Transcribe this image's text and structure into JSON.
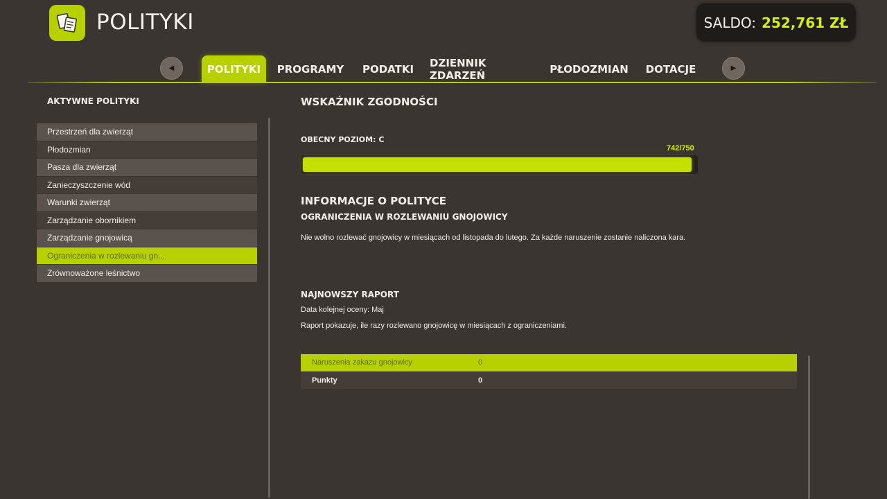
{
  "header": {
    "icon": "documents-icon",
    "title": "POLITYKI",
    "balance_label": "SALDO:",
    "balance_value": "252,761 ZŁ"
  },
  "nav": {
    "prev_icon": "arrow-left-icon",
    "next_icon": "arrow-right-icon",
    "tabs": [
      {
        "label": "POLITYKI",
        "active": true
      },
      {
        "label": "PROGRAMY",
        "active": false
      },
      {
        "label": "PODATKI",
        "active": false
      },
      {
        "label": "DZIENNIK ZDARZEŃ",
        "active": false
      },
      {
        "label": "PŁODOZMIAN",
        "active": false
      },
      {
        "label": "DOTACJE",
        "active": false
      }
    ]
  },
  "sidebar": {
    "heading": "AKTYWNE POLITYKI",
    "items": [
      {
        "label": "Przestrzeń dla zwierząt"
      },
      {
        "label": "Płodozmian"
      },
      {
        "label": "Pasza dla zwierząt"
      },
      {
        "label": "Zanieczyszczenie wód"
      },
      {
        "label": "Warunki zwierząt"
      },
      {
        "label": "Zarządzanie obornikiem"
      },
      {
        "label": "Zarządzanie gnojowicą"
      },
      {
        "label": "Ograniczenia w rozlewaniu gn..."
      },
      {
        "label": "Zrównoważone leśnictwo"
      }
    ],
    "selected_index": 7
  },
  "compliance": {
    "heading": "WSKAŹNIK ZGODNOŚCI",
    "level_label": "OBECNY POZIOM: C",
    "progress_text": "742/750",
    "progress_value": 742,
    "progress_max": 750
  },
  "policy_info": {
    "heading": "INFORMACJE O POLITYCE",
    "policy_name": "OGRANICZENIA W ROZLEWANIU GNOJOWICY",
    "description": "Nie wolno rozlewać gnojowicy w miesiącach od listopada do lutego. Za każde naruszenie zostanie naliczona kara."
  },
  "report": {
    "heading": "NAJNOWSZY RAPORT",
    "next_eval": "Data kolejnej oceny: Maj",
    "description": "Raport pokazuje, ile razy rozlewano gnojowicę w miesiącach z ograniczeniami.",
    "rows": [
      {
        "label": "Naruszenia zakazu gnojowicy",
        "value": "0"
      },
      {
        "label": "Punkty",
        "value": "0"
      }
    ]
  },
  "colors": {
    "accent": "#b6d000",
    "background": "#3b3531",
    "balance_value": "#d4ef12"
  }
}
